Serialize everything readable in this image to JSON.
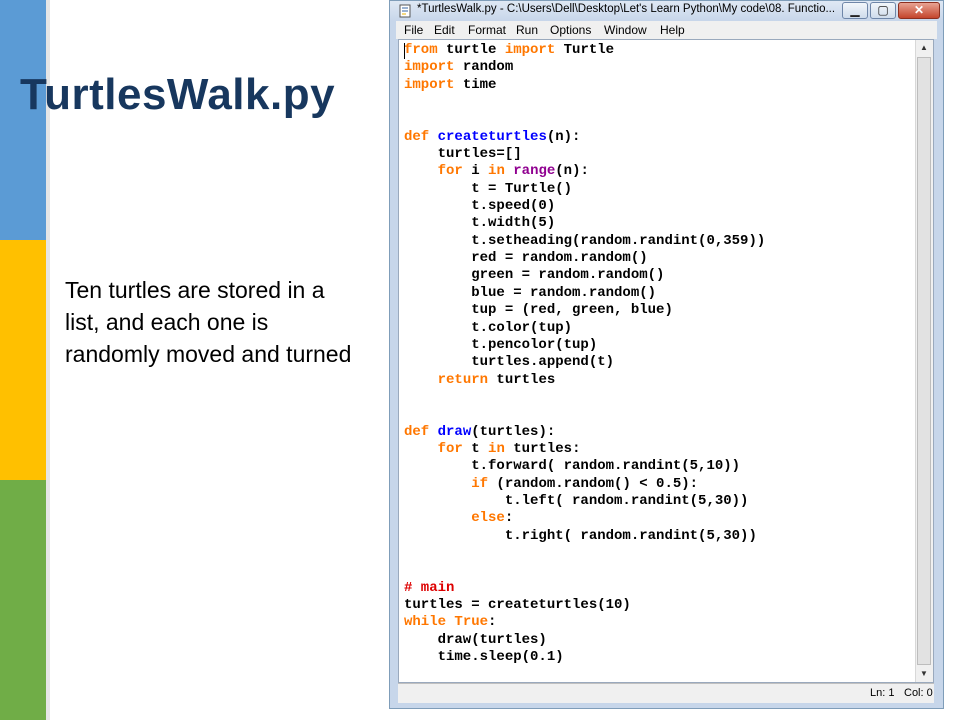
{
  "slide": {
    "title": "TurtlesWalk.py",
    "description": "Ten turtles are stored in a list, and each one is randomly moved and turned",
    "colors": {
      "stripe_top": "#5b9bd5",
      "stripe_middle": "#ffc000",
      "stripe_bottom": "#70ad47",
      "title": "#17375e"
    }
  },
  "window": {
    "title": "*TurtlesWalk.py - C:\\Users\\Dell\\Desktop\\Let's Learn Python\\My code\\08. Functio...",
    "buttons": {
      "minimize": "▁",
      "maximize": "▢",
      "close": "✕"
    },
    "icon": "idle-document-icon"
  },
  "menubar": [
    "File",
    "Edit",
    "Format",
    "Run",
    "Options",
    "Window",
    "Help"
  ],
  "editor": {
    "code_lines": [
      "from turtle import Turtle",
      "import random",
      "import time",
      "",
      "",
      "def createturtles(n):",
      "    turtles=[]",
      "    for i in range(n):",
      "        t = Turtle()",
      "        t.speed(0)",
      "        t.width(5)",
      "        t.setheading(random.randint(0,359))",
      "        red = random.random()",
      "        green = random.random()",
      "        blue = random.random()",
      "        tup = (red, green, blue)",
      "        t.color(tup)",
      "        t.pencolor(tup)",
      "        turtles.append(t)",
      "    return turtles",
      "",
      "",
      "def draw(turtles):",
      "    for t in turtles:",
      "        t.forward( random.randint(5,10))",
      "        if (random.random() < 0.5):",
      "            t.left( random.randint(5,30))",
      "        else:",
      "            t.right( random.randint(5,30))",
      "",
      "",
      "# main",
      "turtles = createturtles(10)",
      "while True:",
      "    draw(turtles)",
      "    time.sleep(0.1)"
    ],
    "syntax_colors": {
      "keyword": "#ff7700",
      "builtin": "#900090",
      "definition": "#0000ff",
      "comment": "#dd0000"
    }
  },
  "statusbar": {
    "line": "Ln: 1",
    "col": "Col: 0"
  }
}
